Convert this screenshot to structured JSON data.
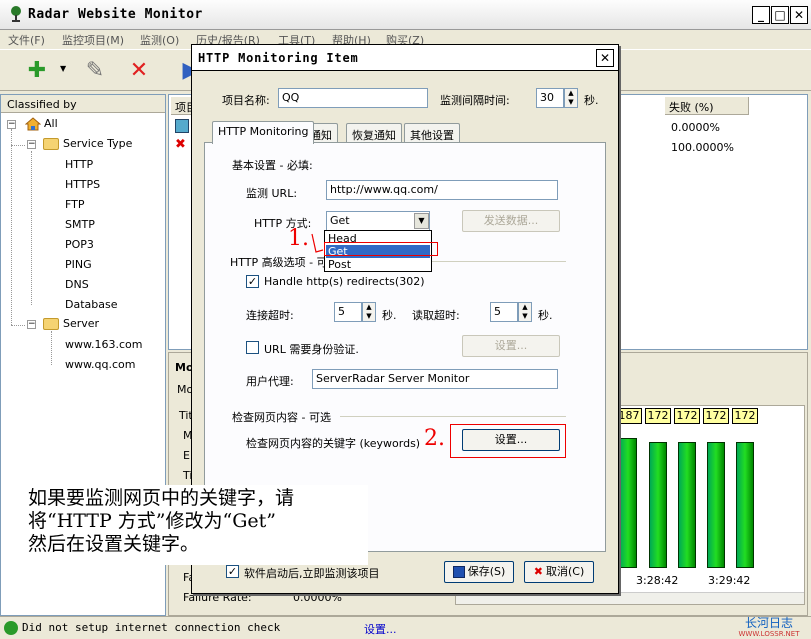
{
  "app": {
    "title": "Radar Website Monitor"
  },
  "menu": [
    "文件(F)",
    "监控项目(M)",
    "监测(O)",
    "历史/报告(R)",
    "工具(T)",
    "帮助(H)",
    "购买(Z)"
  ],
  "left_panel": {
    "header": "Classified by",
    "tree": {
      "all": "All",
      "service_type": "Service Type",
      "services": [
        "HTTP",
        "HTTPS",
        "FTP",
        "SMTP",
        "POP3",
        "PING",
        "DNS",
        "Database"
      ],
      "server": "Server",
      "servers": [
        "www.163.com",
        "www.qq.com"
      ]
    }
  },
  "grid": {
    "col_item": "项目",
    "col_fail": "失败 (%)",
    "rows": [
      {
        "fail": "0.0000%"
      },
      {
        "fail": "100.0000%"
      }
    ]
  },
  "bottom": {
    "tab_label": "Mo",
    "sub_label": "Mo",
    "title_col": "Tit",
    "row_labels": [
      "M",
      "El",
      "Ti",
      "Ti"
    ],
    "fa_label": "Fa",
    "failure_rate_label": "Failure Rate:",
    "failure_rate_value": "0.0000%",
    "chart": {
      "value_labels": [
        "187",
        "172",
        "172",
        "172",
        "172"
      ],
      "time_labels": [
        "3:28:42",
        "3:29:42"
      ]
    }
  },
  "status": {
    "text": "Did not setup internet connection check",
    "link": "设置...",
    "logo": "长河日志",
    "logo_url": "WWW.LOSSR.NET"
  },
  "dialog": {
    "title": "HTTP Monitoring Item",
    "name_label": "项目名称:",
    "name_value": "QQ",
    "interval_label": "监测间隔时间:",
    "interval_value": "30",
    "interval_unit": "秒.",
    "tabs": [
      "HTTP Monitoring",
      "通知",
      "恢复通知",
      "其他设置"
    ],
    "basic_section": "基本设置 - 必填:",
    "url_label": "监测 URL:",
    "url_value": "http://www.qq.com/",
    "method_label": "HTTP 方式:",
    "method_value": "Get",
    "method_options": [
      "Head",
      "Get",
      "Post"
    ],
    "send_data_btn": "发送数据...",
    "advanced_section": "HTTP 高级选项 - 可",
    "redirect_label": "Handle http(s) redirects(302)",
    "conn_timeout_label": "连接超时:",
    "conn_timeout_value": "5",
    "read_timeout_label": "读取超时:",
    "read_timeout_value": "5",
    "sec_unit": "秒.",
    "auth_label": "URL 需要身份验证.",
    "auth_btn": "设置...",
    "agent_label": "用户代理:",
    "agent_value": "ServerRadar Server Monitor",
    "content_section": "检查网页内容 - 可选",
    "keyword_label": "检查网页内容的关键字 (keywords)",
    "keyword_btn": "设置...",
    "autostart_label": "软件启动后,立即监测该项目",
    "save_btn": "保存(S)",
    "cancel_btn": "取消(C)"
  },
  "annotations": {
    "mark1": "1.",
    "mark2": "2.",
    "note_lines": [
      "如果要监测网页中的关键字，请",
      "将“HTTP 方式”修改为“Get”",
      "然后在设置关键字。"
    ]
  }
}
